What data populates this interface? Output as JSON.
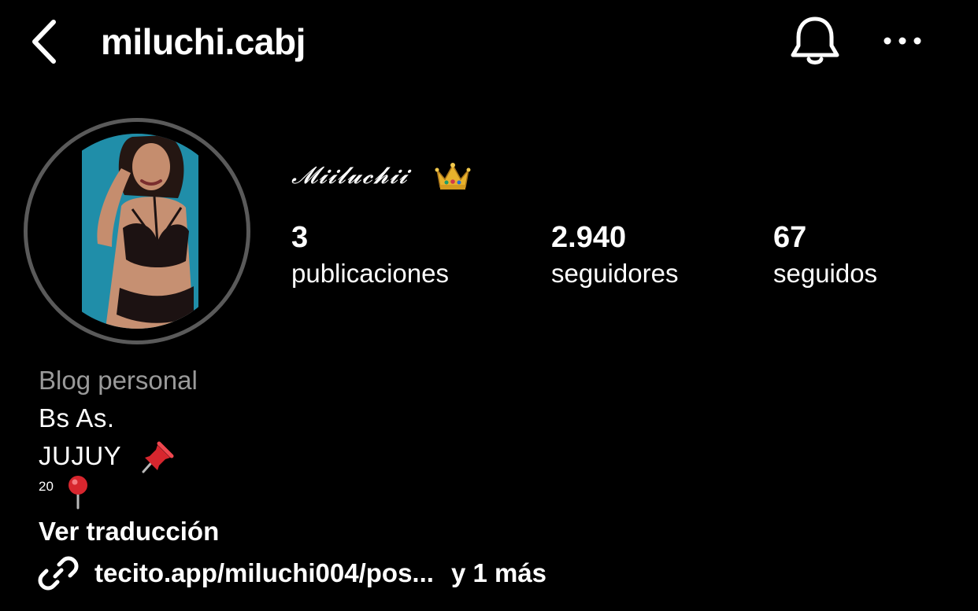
{
  "header": {
    "username": "miluchi.cabj",
    "icons": {
      "back": "chevron-left-icon",
      "notifications": "bell-icon",
      "more": "more-horizontal-icon"
    }
  },
  "profile": {
    "display_name": "𝓜𝓲𝓲𝓵𝓾𝓬𝓱𝓲𝓲",
    "avatar": "profile-photo",
    "stats": [
      {
        "value": "3",
        "label": "publicaciones"
      },
      {
        "value": "2.940",
        "label": "seguidores"
      },
      {
        "value": "67",
        "label": "seguidos"
      }
    ]
  },
  "bio": {
    "category": "Blog personal",
    "lines": [
      "Bs As.",
      "JUJUY"
    ],
    "age": "20",
    "translate_label": "Ver traducción",
    "link_text": "tecito.app/miluchi004/pos...",
    "link_more": "y 1 más"
  },
  "colors": {
    "background": "#000000",
    "text": "#ffffff",
    "muted": "#9a9a9a",
    "ring": "#5a5a5a"
  }
}
